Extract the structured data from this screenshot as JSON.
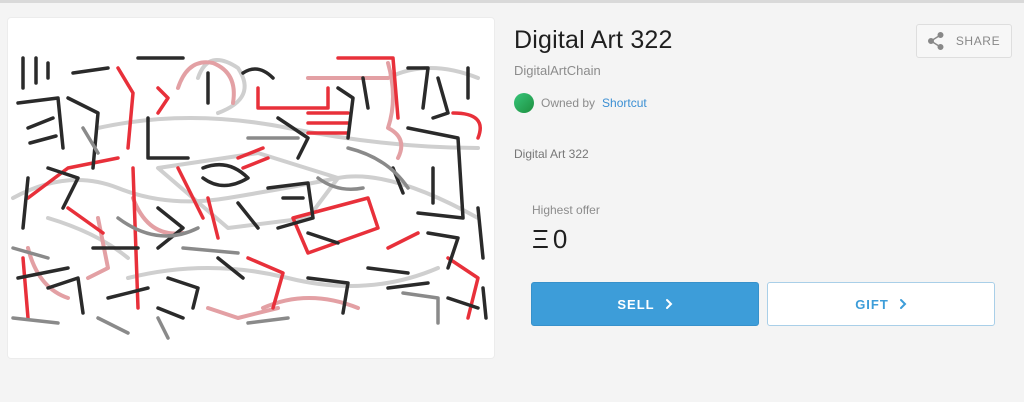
{
  "asset": {
    "title": "Digital Art 322",
    "collection": "DigitalArtChain",
    "owner_prefix": "Owned by",
    "owner_name": "Shortcut",
    "description": "Digital Art 322",
    "artwork_alt": "Digital Art 322 artwork"
  },
  "share": {
    "label": "SHARE",
    "icon": "share-icon"
  },
  "offer": {
    "label": "Highest offer",
    "currency_symbol": "Ξ",
    "amount": "0"
  },
  "actions": {
    "sell_label": "SELL",
    "gift_label": "GIFT"
  },
  "colors": {
    "accent": "#3d9dd9",
    "owner_link": "#3b8fd3",
    "art_red": "#e8303a",
    "art_pink": "#e8a0a3"
  }
}
